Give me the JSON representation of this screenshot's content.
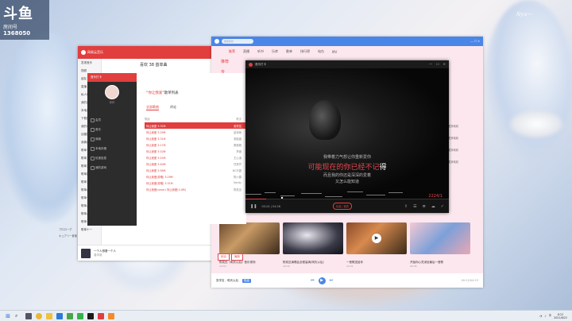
{
  "watermark": {
    "logo": "斗鱼",
    "subtitle": "房间号",
    "room": "1368050"
  },
  "wallpaper": {
    "nya": "Nya~"
  },
  "netease": {
    "app_title": "网易云音乐",
    "playlist_title": "喜欢 38 首单曲",
    "sidebar": [
      "发现音乐",
      "视频",
      "朋友",
      "直播",
      "私人FM",
      "我的音乐",
      "本地音乐",
      "下载管理",
      "我的收藏",
      "创建的歌单",
      "我喜欢的音乐",
      "歌单一",
      "歌单二",
      "歌单三",
      "歌单四",
      "歌单五",
      "歌单六",
      "歌单七",
      "歌单八",
      "歌单九",
      "歌单十",
      "歌单十一"
    ],
    "bottom_song": "一个人想着一个人",
    "bottom_artist": "曾沛慈",
    "extra_rows": [
      "プロローグ",
      "キュアリー音楽"
    ]
  },
  "popup": {
    "header": "音乐打卡",
    "user": "你好",
    "menu": [
      "会员",
      "音乐",
      "商城",
      "本地存储",
      "优惠信息",
      "我的游戏"
    ]
  },
  "playlist": {
    "title_prefix": "“",
    "title_name": "你让我爱",
    "title_suffix": "”歌单列表",
    "tabs": [
      "全部歌曲",
      "评论"
    ],
    "head_left": "歌曲",
    "head_right": "歌手",
    "rows": [
      {
        "name": "你让我爱 3:32M",
        "artist": "张学友"
      },
      {
        "name": "你让我爱 3:29M",
        "artist": "赵钶雨"
      },
      {
        "name": "你让我爱 3:31M",
        "artist": "张韶涵"
      },
      {
        "name": "你让我爱 3:17M",
        "artist": "蔡健雅"
      },
      {
        "name": "你让我爱 3:10M",
        "artist": "李健"
      },
      {
        "name": "你让我爱 3:25M",
        "artist": "王心凌"
      },
      {
        "name": "你让我爱 3:40M",
        "artist": "任贤齐"
      },
      {
        "name": "你让我爱 2:58M",
        "artist": "BC乐团"
      },
      {
        "name": "你让我爱(原唱) 3:29M",
        "artist": "陈小春"
      },
      {
        "name": "你让我爱(原唱) 3:31M",
        "artist": "Nerdy"
      },
      {
        "name": "你让我爱(cover) 你让我爱(1:0M)",
        "artist": "陈奕迅"
      }
    ]
  },
  "kugou": {
    "search_placeholder": "搜索音乐",
    "nav": [
      "推荐",
      "直播",
      "听书",
      "乐库",
      "歌单",
      "排行榜",
      "电台",
      "MV"
    ],
    "side": [
      "推荐",
      "专",
      "精"
    ],
    "tabs": [
      "综合",
      "最新"
    ],
    "right_items": [
      "更多精彩",
      "更多精彩",
      "更多精彩",
      "更多精彩"
    ],
    "captions": [
      {
        "title": "陈奕迅《明天以后》音乐现场",
        "meta": "24:54"
      },
      {
        "title": "陈奕迅演唱会全程高清(明天以后)",
        "meta": "18:34"
      },
      {
        "title": "一首歌送给你",
        "meta": "10:21"
      },
      {
        "title": "开始你心灵深处最后一首歌",
        "meta": "09:45"
      }
    ],
    "now_playing": "张学友 - 明天以后",
    "badge": "极高",
    "time": "00:12/04:23"
  },
  "video": {
    "title": "音乐打卡",
    "lyric1": "我带着力气想让你重新爱你",
    "lyric2_red": "可能现在的你已经不记",
    "lyric2_white": "得",
    "lyric3": "而且我的你还是深深的爱着",
    "lyric4": "又怎么能知道",
    "time_right": "2224/1",
    "time": "00:24 | 04:26",
    "tag": "标准 | 音质",
    "progress": 0.1
  },
  "taskbar": {
    "time": "8:22",
    "date": "2021/6/22",
    "lang": "中"
  }
}
